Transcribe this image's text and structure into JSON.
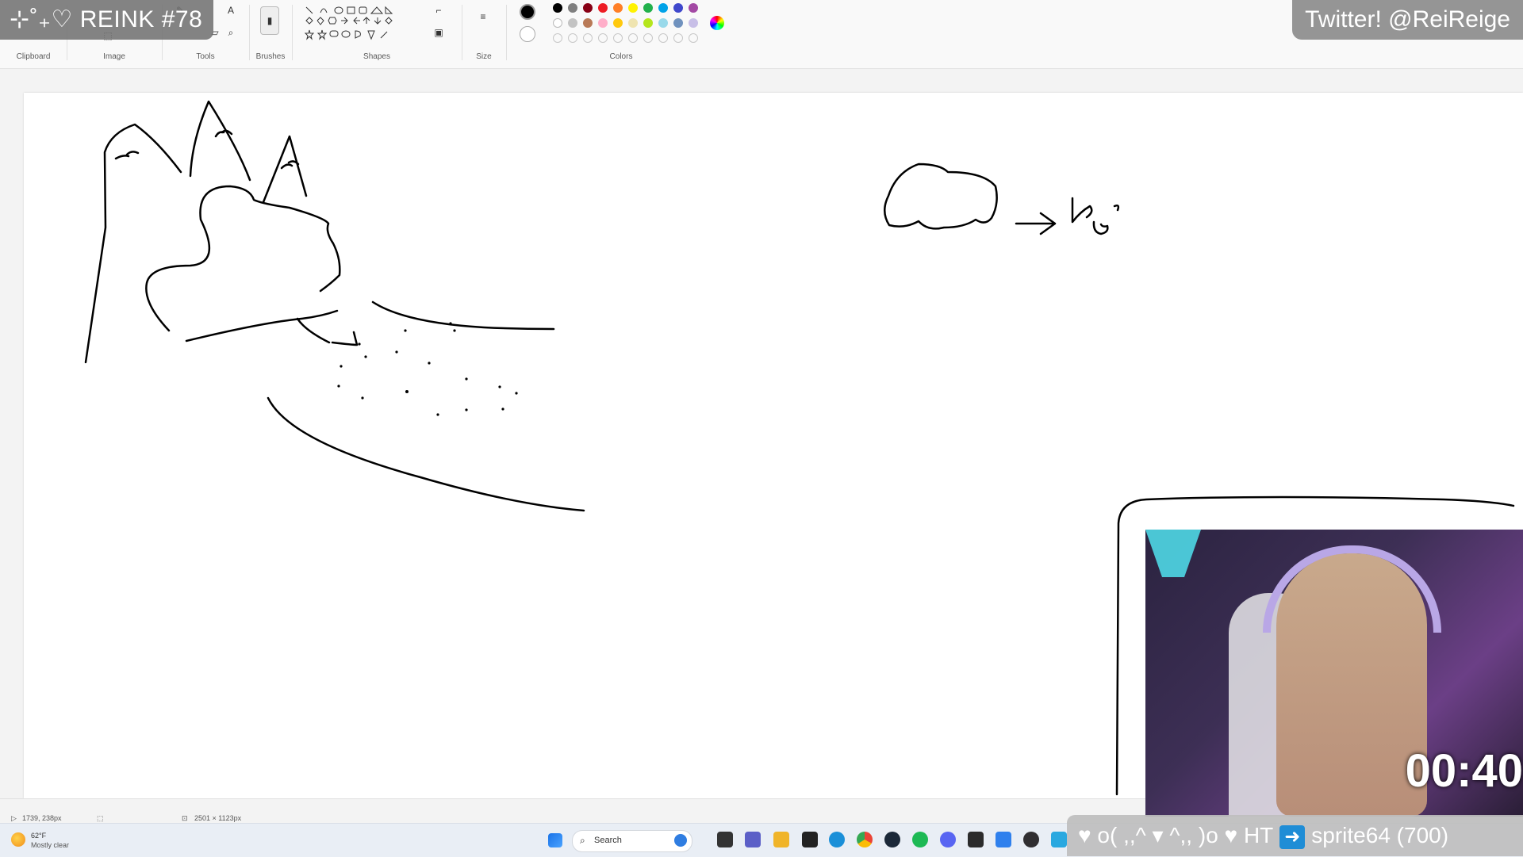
{
  "stream": {
    "title": "⊹˚₊♡ REINK #78",
    "twitter": "Twitter! @ReiReige",
    "alert": {
      "prefix": "♥ o( ,,^ ▾ ^,, )o ♥ HT",
      "user": "sprite64 (700)"
    },
    "timer": "00:40"
  },
  "ribbon": {
    "groups": [
      "Clipboard",
      "Image",
      "Tools",
      "Brushes",
      "Shapes",
      "Size",
      "Colors"
    ],
    "colors_row1": [
      "#000000",
      "#7f7f7f",
      "#880015",
      "#ed1c24",
      "#ff7f27",
      "#fff200",
      "#22b14c",
      "#00a2e8",
      "#3f48cc",
      "#a349a4"
    ],
    "colors_row2": [
      "#ffffff",
      "#c3c3c3",
      "#b97a57",
      "#ffaec9",
      "#ffc90e",
      "#efe4b0",
      "#b5e61d",
      "#99d9ea",
      "#7092be",
      "#c8bfe7"
    ],
    "primary_color": "#000000",
    "secondary_color": "#ffffff"
  },
  "status": {
    "cursor_pos": "1739, 238px",
    "canvas_size": "2501 × 1123px"
  },
  "weather": {
    "temp": "62°F",
    "condition": "Mostly clear"
  },
  "taskbar": {
    "search_placeholder": "Search"
  }
}
